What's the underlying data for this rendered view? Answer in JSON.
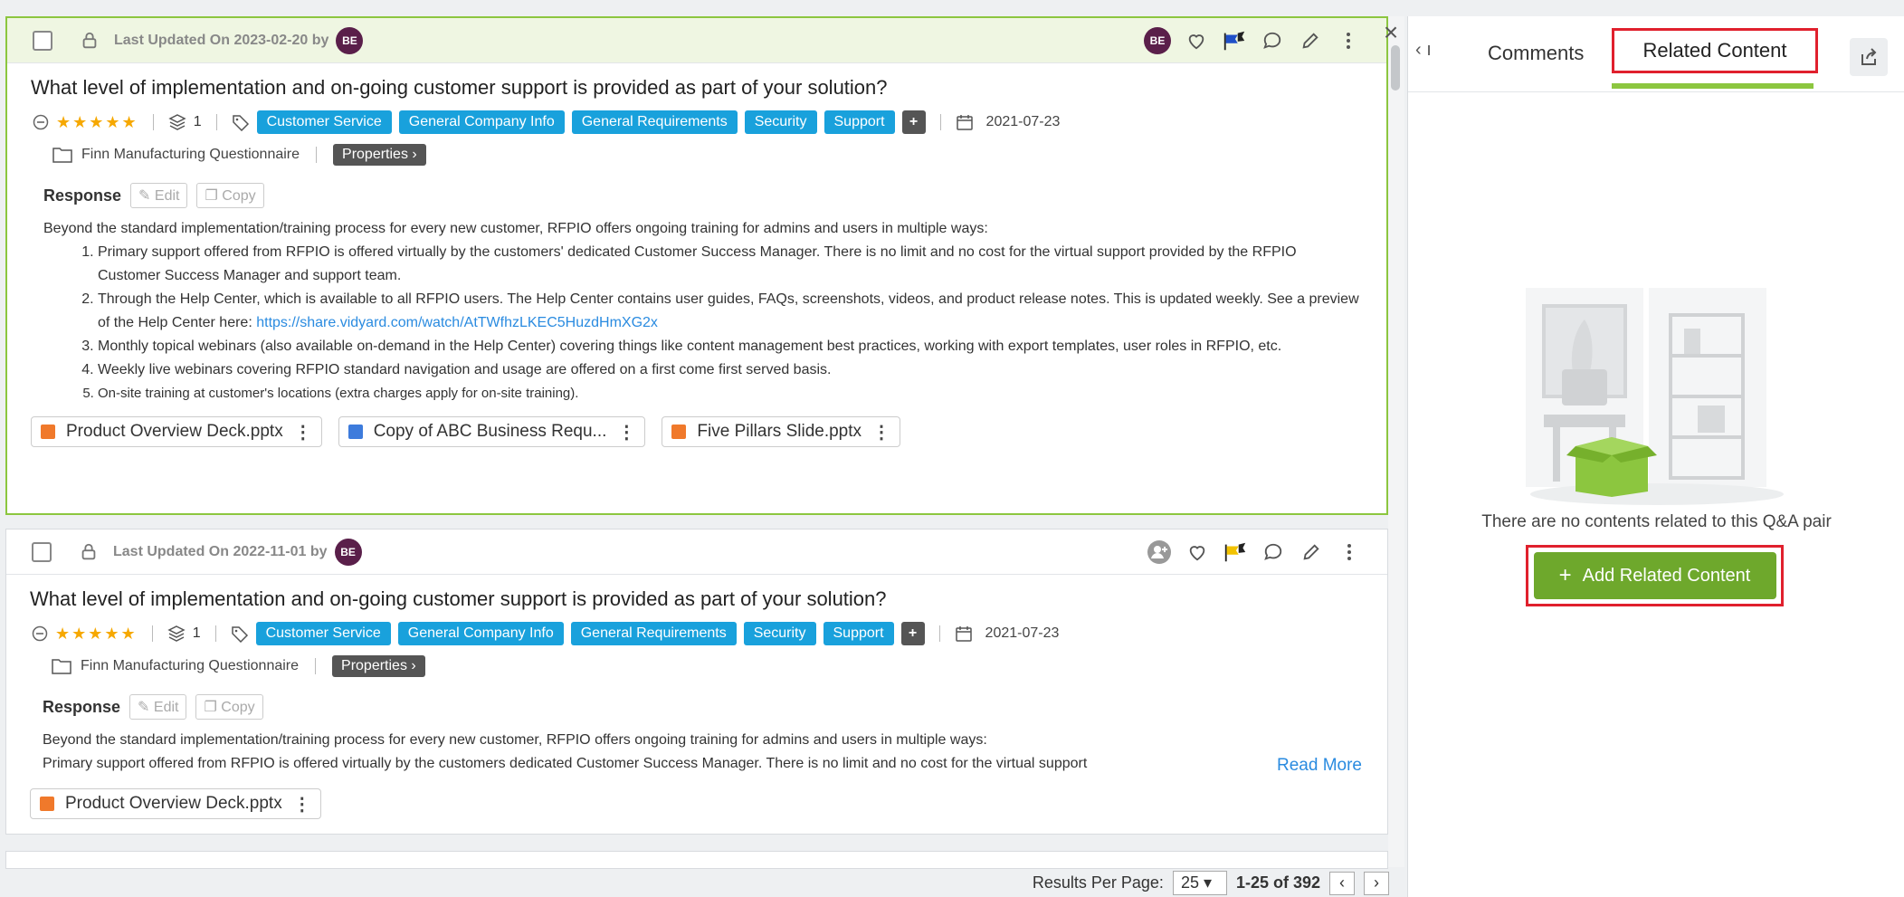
{
  "cards": [
    {
      "updated_text": "Last Updated On 2023-02-20 by",
      "avatar": "BE",
      "header_avatar": "BE",
      "question": "What level of implementation and on-going customer support is provided as part of your solution?",
      "stars": "★★★★★",
      "version_count": "1",
      "tags": [
        "Customer Service",
        "General Company Info",
        "General Requirements",
        "Security",
        "Support"
      ],
      "plus": "+",
      "date": "2021-07-23",
      "folder": "Finn Manufacturing Questionnaire",
      "properties_label": "Properties",
      "response_label": "Response",
      "edit_label": "Edit",
      "copy_label": "Copy",
      "intro": "Beyond the standard implementation/training process for every new customer, RFPIO offers ongoing training for admins and users in multiple ways:",
      "items": [
        "Primary support offered from RFPIO is offered virtually by the customers' dedicated Customer Success Manager. There is no limit and no cost for the virtual support provided by the RFPIO Customer Success Manager and support team.",
        "Through the Help Center, which is available to all RFPIO users. The Help Center contains user guides, FAQs, screenshots, videos, and product release notes. This is updated weekly. See a preview of the Help Center here:",
        "Monthly topical webinars (also available on-demand in the Help Center) covering things like content management best practices, working with export templates, user roles in RFPIO, etc.",
        "Weekly live webinars covering RFPIO standard navigation and usage are offered on a first come first served basis.",
        "On-site training at customer's locations (extra charges apply for on-site training)."
      ],
      "link": "https://share.vidyard.com/watch/AtTWfhzLKEC5HuzdHmXG2x",
      "attachments": [
        "Product Overview Deck.pptx",
        "Copy of ABC Business Requ...",
        "Five Pillars Slide.pptx"
      ]
    },
    {
      "updated_text": "Last Updated On 2022-11-01 by",
      "avatar": "BE",
      "question": "What level of implementation and on-going customer support is provided as part of your solution?",
      "stars": "★★★★★",
      "version_count": "1",
      "tags": [
        "Customer Service",
        "General Company Info",
        "General Requirements",
        "Security",
        "Support"
      ],
      "plus": "+",
      "date": "2021-07-23",
      "folder": "Finn Manufacturing Questionnaire",
      "properties_label": "Properties",
      "response_label": "Response",
      "edit_label": "Edit",
      "copy_label": "Copy",
      "intro": "Beyond the standard implementation/training process for every new customer, RFPIO offers ongoing training for admins and users in multiple ways:",
      "line2": "Primary support offered from RFPIO is offered virtually by the customers dedicated Customer Success Manager. There is no limit and no cost for the virtual support",
      "read_more": "Read More",
      "attachments": [
        "Product Overview Deck.pptx"
      ]
    }
  ],
  "pager": {
    "label": "Results Per Page:",
    "per_page": "25",
    "count": "1-25 of 392"
  },
  "right_panel": {
    "back": "‹ ı",
    "tab_comments": "Comments",
    "tab_related": "Related Content",
    "empty_text": "There are no contents related to this Q&A pair",
    "add_button": "Add Related Content",
    "add_plus": "+"
  },
  "close": "×",
  "colors": {
    "accent_green": "#8cc63f",
    "tag_blue": "#19a1dc",
    "highlight_red": "#e0202d",
    "add_button_green": "#6ea82c"
  }
}
